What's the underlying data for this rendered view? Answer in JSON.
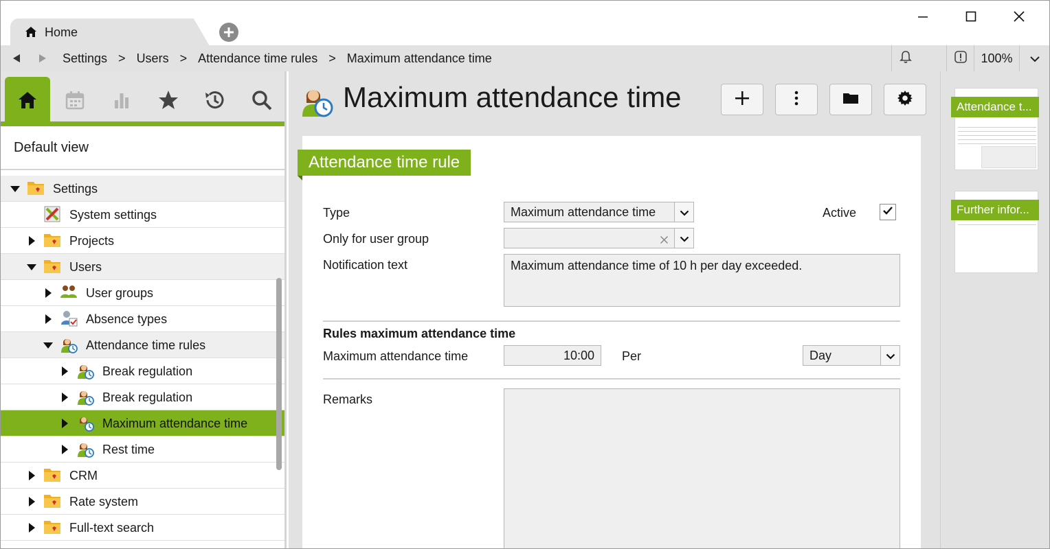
{
  "tabs": [
    {
      "label": "Home",
      "icon": "home-icon"
    }
  ],
  "window": {
    "minimize": "—",
    "maximize": "□",
    "close": "✕"
  },
  "breadcrumb": [
    "Settings",
    "Users",
    "Attendance time rules",
    "Maximum attendance time"
  ],
  "breadcrumb_separator": ">",
  "zoom": "100%",
  "colors": {
    "accent": "#7fb11d",
    "accent_dark": "#4d7a0c",
    "panel_bg": "#e2e2e2"
  },
  "nav_icons": [
    "home-icon",
    "calendar-icon",
    "chart-icon",
    "star-icon",
    "history-icon",
    "search-icon"
  ],
  "view_title": "Default view",
  "tree": [
    {
      "label": "Settings",
      "icon": "folder-icon",
      "toggle": "open"
    },
    {
      "label": "System settings",
      "icon": "tools-icon",
      "toggle": "none"
    },
    {
      "label": "Projects",
      "icon": "folder-icon",
      "toggle": "closed"
    },
    {
      "label": "Users",
      "icon": "folder-icon",
      "toggle": "open"
    },
    {
      "label": "User groups",
      "icon": "user-group-icon",
      "toggle": "closed"
    },
    {
      "label": "Absence types",
      "icon": "absence-icon",
      "toggle": "closed"
    },
    {
      "label": "Attendance time rules",
      "icon": "attendance-icon",
      "toggle": "open"
    },
    {
      "label": "Break regulation",
      "icon": "attendance-icon",
      "toggle": "closed"
    },
    {
      "label": "Break regulation",
      "icon": "attendance-icon",
      "toggle": "closed"
    },
    {
      "label": "Maximum attendance time",
      "icon": "attendance-icon",
      "toggle": "closed",
      "selected": true
    },
    {
      "label": "Rest time",
      "icon": "attendance-icon",
      "toggle": "closed"
    },
    {
      "label": "CRM",
      "icon": "folder-icon",
      "toggle": "closed"
    },
    {
      "label": "Rate system",
      "icon": "folder-icon",
      "toggle": "closed"
    },
    {
      "label": "Full-text search",
      "icon": "folder-icon",
      "toggle": "closed"
    }
  ],
  "page": {
    "title": "Maximum attendance time",
    "toolbar": [
      "add-icon",
      "more-icon",
      "folder-icon",
      "settings-icon"
    ]
  },
  "form": {
    "section_title": "Attendance time rule",
    "type_label": "Type",
    "type_value": "Maximum attendance time",
    "active_label": "Active",
    "active_checked": true,
    "user_group_label": "Only for user group",
    "user_group_value": "",
    "notification_label": "Notification text",
    "notification_value": "Maximum attendance time of 10 h per day exceeded.",
    "rules_title": "Rules maximum attendance time",
    "max_time_label": "Maximum attendance time",
    "max_time_value": "10:00",
    "per_label": "Per",
    "per_value": "Day",
    "remarks_label": "Remarks",
    "remarks_value": ""
  },
  "overview": [
    {
      "label": "Attendance t..."
    },
    {
      "label": "Further infor..."
    }
  ]
}
